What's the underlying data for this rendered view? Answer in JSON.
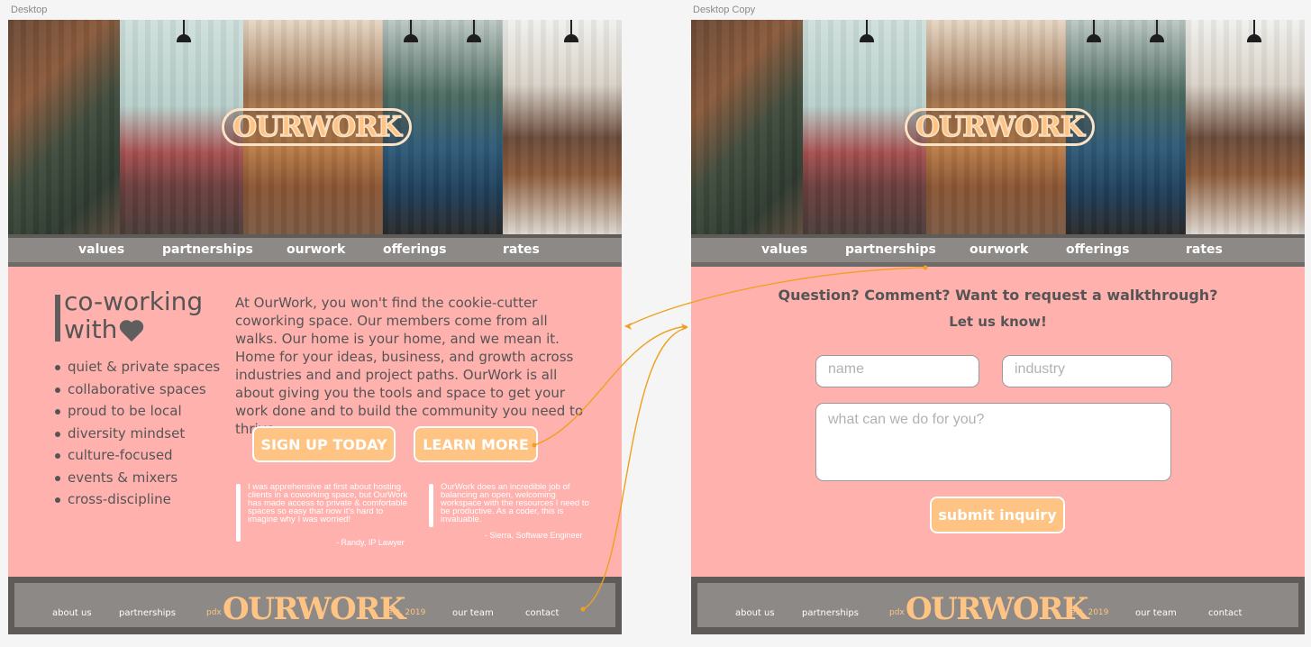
{
  "artboards": {
    "left_label": "Desktop",
    "right_label": "Desktop Copy"
  },
  "brand": {
    "logo": "OURWORK",
    "accent": "#ffc483",
    "page_bg": "#ffb1ae",
    "nav_bg": "#8d8987"
  },
  "nav": {
    "items": [
      {
        "label": "values"
      },
      {
        "label": "partnerships"
      },
      {
        "label": "ourwork"
      },
      {
        "label": "offerings"
      },
      {
        "label": "rates"
      }
    ]
  },
  "home": {
    "title_line1": "co-working",
    "title_line2": "with",
    "features": [
      "quiet & private spaces",
      "collaborative spaces",
      "proud to be local",
      "diversity mindset",
      "culture-focused",
      "events & mixers",
      "cross-discipline"
    ],
    "about": "At OurWork, you won't find the cookie-cutter coworking space. Our members come from all walks. Our home is your home, and we mean it. Home for your ideas, business, and growth across industries and and project paths. OurWork is all about giving you the tools and space to get your work done and to build the community you need to thrive.",
    "signup_label": "SIGN UP TODAY",
    "learn_label": "LEARN MORE",
    "testimonials": [
      {
        "text": "I was apprehensive at first about hosting clients in a coworking space, but OurWork has made access to private & comfortable spaces so easy that now it's hard to imagine why I was worried!",
        "author": "- Randy, IP Lawyer"
      },
      {
        "text": "OurWork does an incredible job of balancing an open, welcoming workspace with the resources I need to be productive. As a coder, this is invaluable.",
        "author": "- Sierra, Software Engineer"
      }
    ]
  },
  "contact": {
    "line1": "Question? Comment? Want to request a walkthrough?",
    "line2": "Let us know!",
    "name_placeholder": "name",
    "industry_placeholder": "industry",
    "message_placeholder": "what can we do for you?",
    "submit_label": "submit inquiry"
  },
  "footer": {
    "about": "about us",
    "partnerships": "partnerships",
    "pdx": "pdx",
    "logo": "OURWORK",
    "est": "est. 2019",
    "team": "our team",
    "contact": "contact"
  }
}
